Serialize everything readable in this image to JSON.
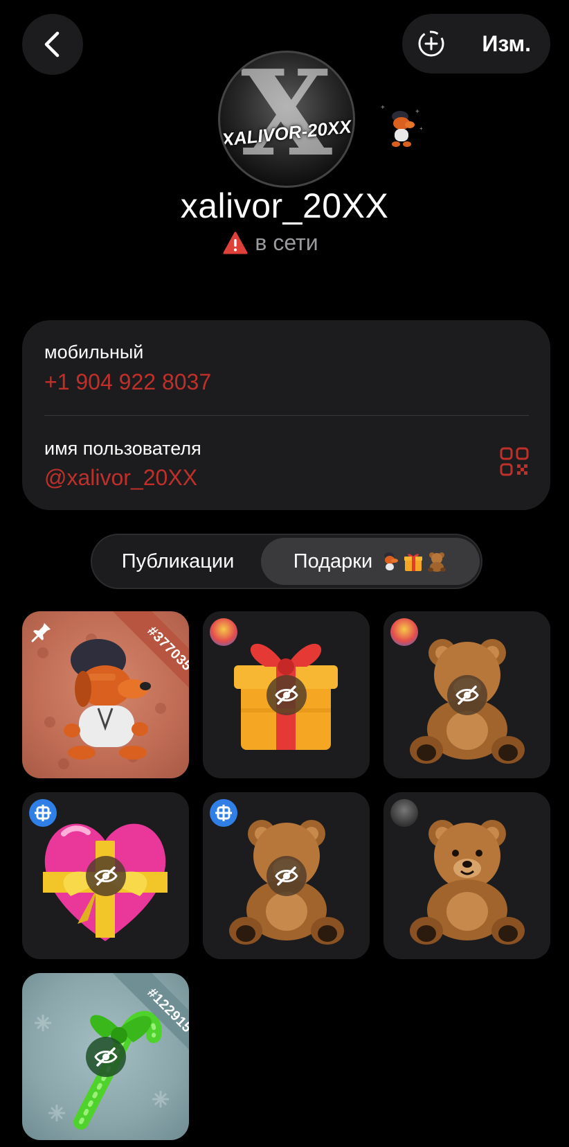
{
  "header": {
    "edit_label": "Изм."
  },
  "profile": {
    "avatar_text": "XALIVOR-20XX",
    "avatar_letter": "X",
    "display_name": "xalivor_20XX",
    "status": "в сети"
  },
  "info": {
    "mobile_label": "мобильный",
    "mobile_value": "+1 904 922 8037",
    "username_label": "имя пользователя",
    "username_value": "@xalivor_20XX"
  },
  "tabs": [
    {
      "label": "Публикации",
      "active": false
    },
    {
      "label": "Подарки",
      "active": true,
      "emojis": [
        "🐕",
        "🎁",
        "🧸"
      ]
    }
  ],
  "gifts": [
    {
      "name": "dog-collectible",
      "number": "#377035",
      "pinned": true,
      "hidden": false
    },
    {
      "name": "gift-box",
      "hidden": true,
      "sender": "avatar"
    },
    {
      "name": "teddy-bear",
      "hidden": true,
      "sender": "avatar"
    },
    {
      "name": "heart-with-bow",
      "hidden": true,
      "sender": "blue-badge"
    },
    {
      "name": "teddy-bear",
      "hidden": true,
      "sender": "blue-badge"
    },
    {
      "name": "teddy-bear",
      "hidden": false,
      "sender": "gray-avatar"
    },
    {
      "name": "candy-cane",
      "number": "#122915",
      "hidden": true
    }
  ],
  "colors": {
    "accent_red": "#c0302b",
    "card_bg": "#1c1c1e",
    "background": "#000000"
  }
}
